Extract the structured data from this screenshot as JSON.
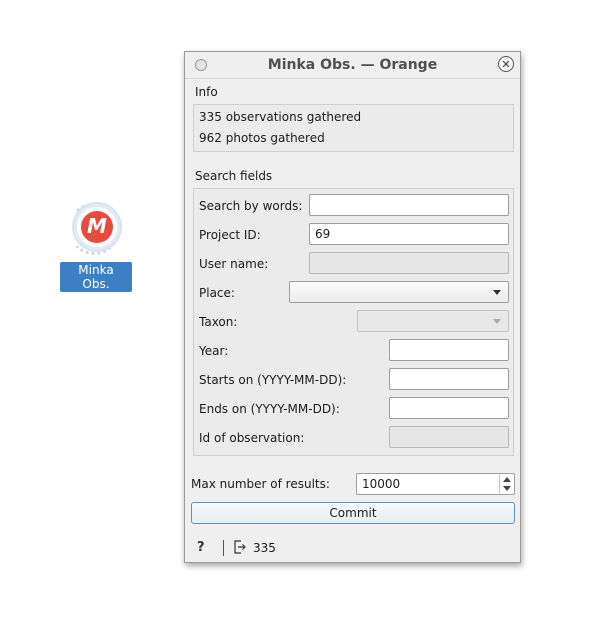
{
  "desktop": {
    "widget_label": "Minka Obs.",
    "widget_icon_letter": "M",
    "widget_icon": "minka-logo-icon"
  },
  "window": {
    "title": "Minka Obs. — Orange",
    "close_glyph": "✕",
    "info": {
      "label": "Info",
      "observations": "335 observations gathered",
      "photos": "962 photos gathered"
    },
    "search": {
      "label": "Search fields",
      "words_label": "Search by words:",
      "words_value": "",
      "project_label": "Project ID:",
      "project_value": "69",
      "user_label": "User name:",
      "user_value": "",
      "place_label": "Place:",
      "place_value": "",
      "taxon_label": "Taxon:",
      "taxon_value": "",
      "year_label": "Year:",
      "year_value": "",
      "starts_label": "Starts on (YYYY-MM-DD):",
      "starts_value": "",
      "ends_label": "Ends on (YYYY-MM-DD):",
      "ends_value": "",
      "id_label": "Id of observation:",
      "id_value": ""
    },
    "max_results": {
      "label": "Max number of results:",
      "value": "10000"
    },
    "commit_label": "Commit",
    "status": {
      "help_glyph": "?",
      "output_count": "335"
    }
  },
  "colors": {
    "accent": "#3c7fc4",
    "logo_red": "#e84a3e",
    "commit_border": "#5e8fc4"
  }
}
